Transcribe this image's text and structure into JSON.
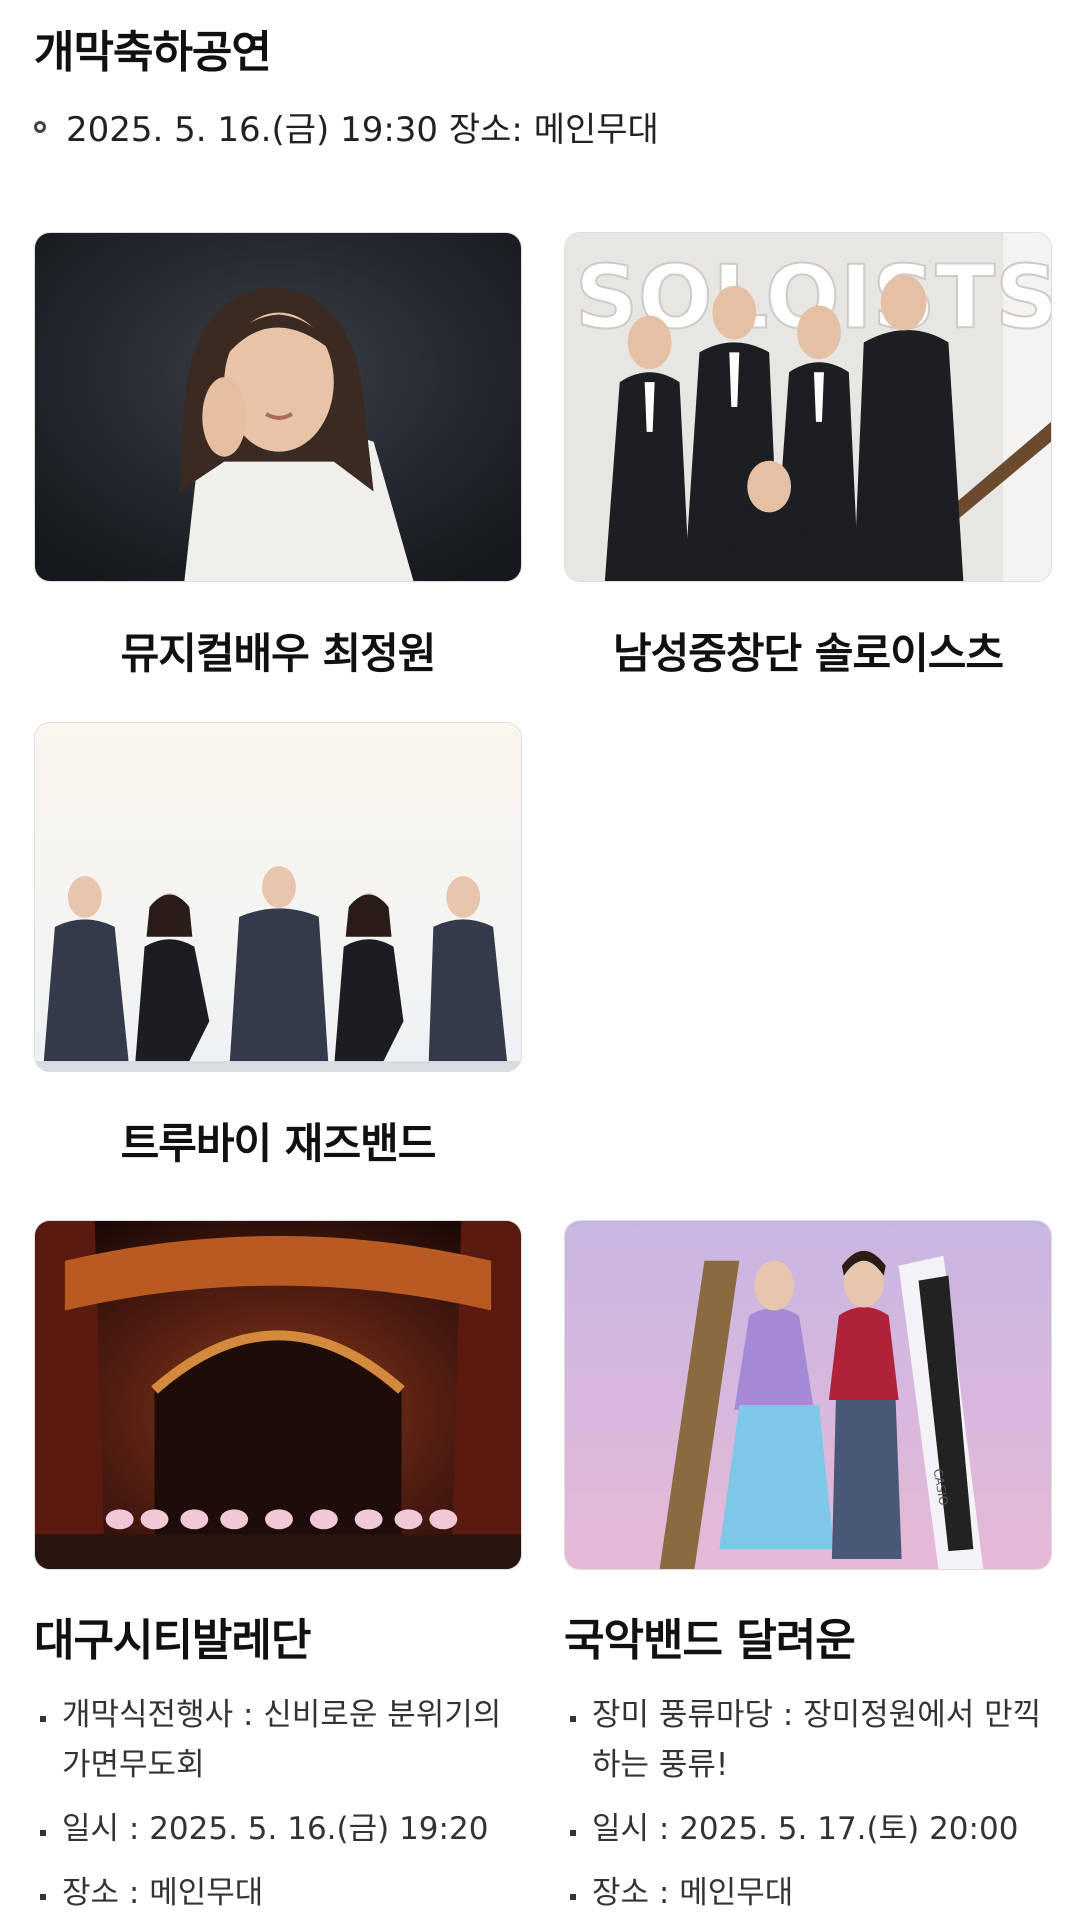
{
  "section": {
    "title": "개막축하공연",
    "schedule": "2025. 5. 16.(금) 19:30 장소: 메인무대"
  },
  "performers": [
    {
      "name": "뮤지컬배우 최정원"
    },
    {
      "name": "남성중창단 솔로이스츠"
    },
    {
      "name": "트루바이 재즈밴드"
    }
  ],
  "programs": [
    {
      "name": "대구시티발레단",
      "details": [
        "개막식전행사 : 신비로운 분위기의 가면무도회",
        "일시 : 2025. 5. 16.(금) 19:20",
        "장소 : 메인무대"
      ]
    },
    {
      "name": "국악밴드 달려운",
      "details": [
        "장미 풍류마당 : 장미정원에서 만끽하는 풍류!",
        "일시 : 2025. 5. 17.(토) 20:00",
        "장소 : 메인무대"
      ]
    }
  ],
  "photo_texts": {
    "soloists_wall": "SOLOISTS",
    "keyboard_brand": "CASIO"
  },
  "colors": {
    "text": "#111111",
    "photo_border": "#dddddd"
  }
}
